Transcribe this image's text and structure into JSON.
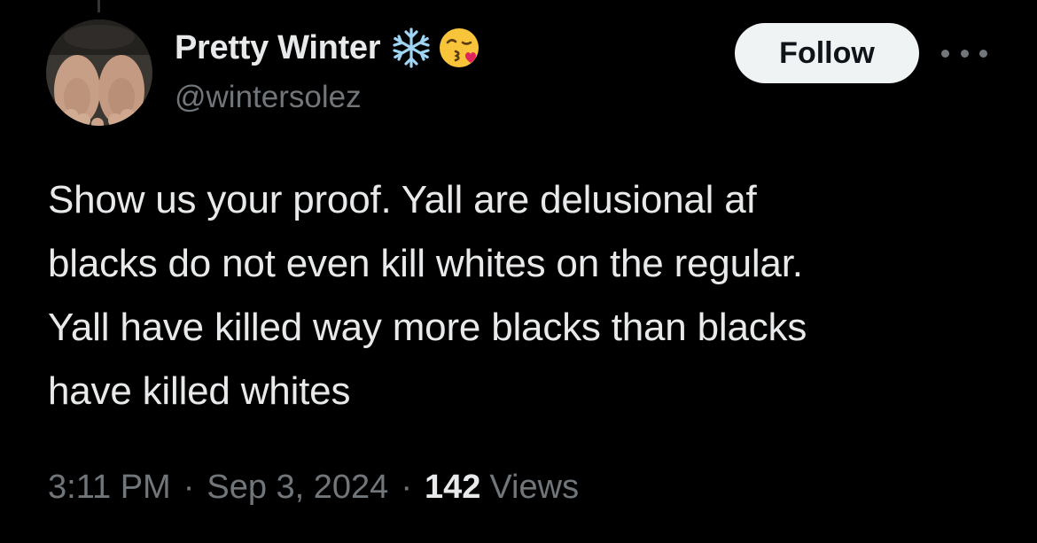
{
  "tweet": {
    "author": {
      "display_name": "Pretty Winter",
      "handle": "@wintersolez",
      "name_emojis": [
        "snowflake-emoji",
        "kissing-face-emoji"
      ],
      "avatar": "profile-photo"
    },
    "follow_label": "Follow",
    "more_icon": "more-dots-icon",
    "text_lines": [
      "Show us your proof. Yall are delusional af",
      "blacks do not even kill whites on the regular.",
      "Yall have killed way more blacks than blacks",
      "have killed whites"
    ],
    "time": "3:11 PM",
    "date": "Sep 3, 2024",
    "separator": "·",
    "views_count": "142",
    "views_label": "Views"
  },
  "colors": {
    "background": "#000000",
    "primary_text": "#e7e9ea",
    "secondary_text": "#71767b",
    "follow_button_bg": "#eff3f4",
    "follow_button_text": "#0f1419",
    "snowflake": "#9fd4f2"
  }
}
